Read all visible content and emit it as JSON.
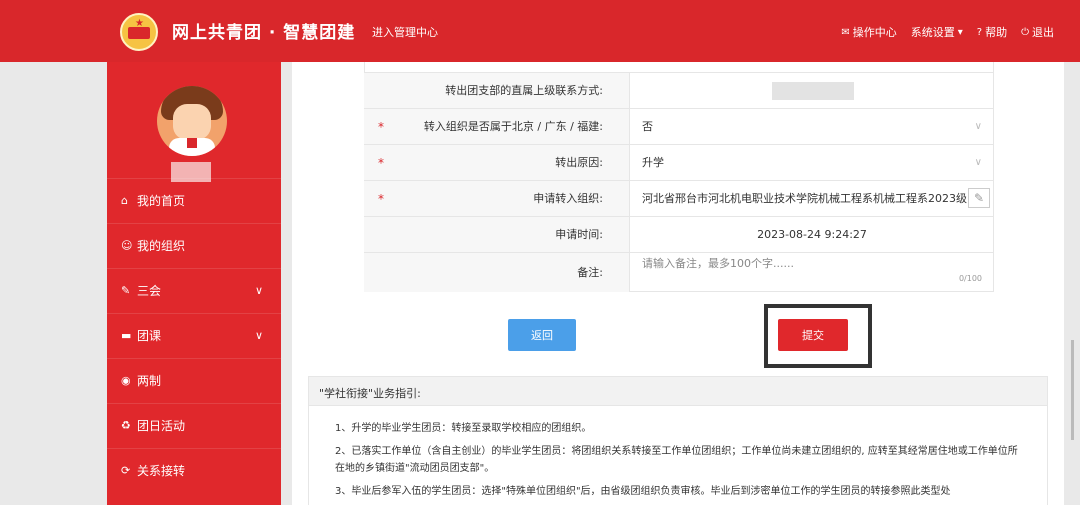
{
  "header": {
    "brand": "网上共青团 · 智慧团建",
    "manage_link": "进入管理中心",
    "menu": {
      "ops": "操作中心",
      "settings": "系统设置",
      "help": "帮助",
      "logout": "退出"
    }
  },
  "sidebar": {
    "items": [
      {
        "label": "我的首页"
      },
      {
        "label": "我的组织"
      },
      {
        "label": "三会"
      },
      {
        "label": "团课"
      },
      {
        "label": "两制"
      },
      {
        "label": "团日活动"
      },
      {
        "label": "关系接转"
      }
    ]
  },
  "form": {
    "rows": [
      {
        "label": "转出团支部的直属上级联系方式:",
        "required": false,
        "value": ""
      },
      {
        "label": "转入组织是否属于北京 / 广东 / 福建:",
        "required": true,
        "value": "否"
      },
      {
        "label": "转出原因:",
        "required": true,
        "value": "升学"
      },
      {
        "label": "申请转入组织:",
        "required": true,
        "value": "河北省邢台市河北机电职业技术学院机械工程系机械工程系2023级"
      },
      {
        "label": "申请时间:",
        "required": false,
        "value": "2023-08-24 9:24:27"
      },
      {
        "label": "备注:",
        "required": false,
        "placeholder": "请输入备注，最多100个字......",
        "counter": "0/100"
      }
    ],
    "required_mark": "*"
  },
  "buttons": {
    "back": "返回",
    "submit": "提交"
  },
  "guide": {
    "title": "\"学社衔接\"业务指引:",
    "lines": [
      "1、升学的毕业学生团员：转接至录取学校相应的团组织。",
      "2、已落实工作单位（含自主创业）的毕业学生团员：将团组织关系转接至工作单位团组织；工作单位尚未建立团组织的, 应转至其经常居住地或工作单位所在地的乡镇街道\"流动团员团支部\"。",
      "3、毕业后参军入伍的学生团员：选择\"特殊单位团组织\"后，由省级团组织负责审核。毕业后到涉密单位工作的学生团员的转接参照此类型处"
    ]
  },
  "colors": {
    "primary_red": "#d9272b",
    "blue": "#4b9fe9"
  }
}
